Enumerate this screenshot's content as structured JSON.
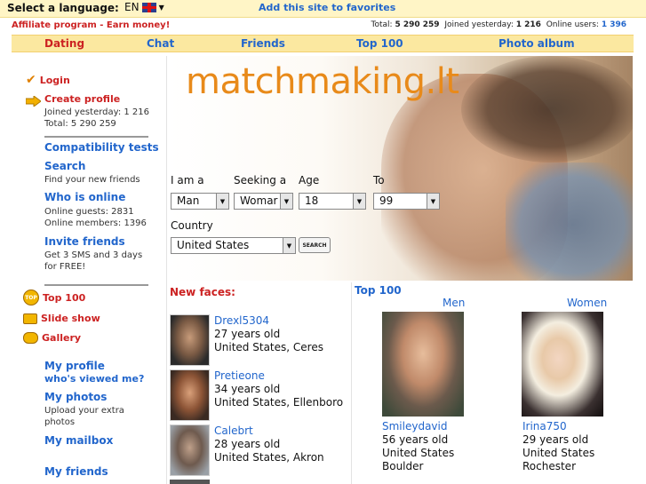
{
  "topbar": {
    "language_label": "Select a language:",
    "language_value": "EN",
    "favorites_link": "Add this site to favorites"
  },
  "affiliate": "Affiliate program - Earn money!",
  "stats": {
    "total_label": "Total:",
    "total_value": "5 290 259",
    "joined_label": "Joined yesterday:",
    "joined_value": "1 216",
    "online_label": "Online users:",
    "online_value": "1 396"
  },
  "nav": [
    "Dating",
    "Chat",
    "Friends",
    "Top 100",
    "Photo album"
  ],
  "sidebar": {
    "login": "Login",
    "create_profile": "Create profile",
    "joined_line": "Joined yesterday: 1 216",
    "total_line": "Total: 5 290 259",
    "compat": "Compatibility tests",
    "search": "Search",
    "search_desc": "Find your new friends",
    "who_online": "Who is online",
    "online_guests": "Online guests: 2831",
    "online_members": "Online members: 1396",
    "invite": "Invite friends",
    "invite_desc": "Get 3 SMS and 3 days for FREE!",
    "top100": "Top 100",
    "slideshow": "Slide show",
    "gallery": "Gallery",
    "my_profile": "My profile",
    "whos_viewed": "who's viewed me?",
    "my_photos": "My photos",
    "photos_desc": "Upload your extra photos",
    "my_mailbox": "My mailbox",
    "my_friends": "My friends"
  },
  "hero": {
    "brand": "matchmaking.lt",
    "i_am_label": "I am a",
    "seeking_label": "Seeking a",
    "age_label": "Age",
    "to_label": "To",
    "country_label": "Country",
    "i_am_value": "Man",
    "seeking_value": "Womar",
    "age_from": "18",
    "age_to": "99",
    "country_value": "United States",
    "search_button": "SEARCH"
  },
  "new_faces": {
    "title": "New faces:",
    "items": [
      {
        "name": "Drexl5304",
        "age": "27 years old",
        "location": "United States, Ceres"
      },
      {
        "name": "Pretieone",
        "age": "34 years old",
        "location": "United States, Ellenboro"
      },
      {
        "name": "Calebrt",
        "age": "28 years old",
        "location": "United States, Akron"
      }
    ]
  },
  "top100": {
    "title": "Top 100",
    "men_label": "Men",
    "women_label": "Women",
    "man": {
      "name": "Smileydavid",
      "age": "56 years old",
      "country": "United States",
      "city": "Boulder"
    },
    "woman": {
      "name": "Irina750",
      "age": "29 years old",
      "country": "United States",
      "city": "Rochester"
    }
  },
  "colors": {
    "accent_blue": "#2266cc",
    "accent_red": "#cc2222",
    "brand_orange": "#e88a1a",
    "nav_bg": "#fbe8a0",
    "topbar_bg": "#fff5c6"
  }
}
